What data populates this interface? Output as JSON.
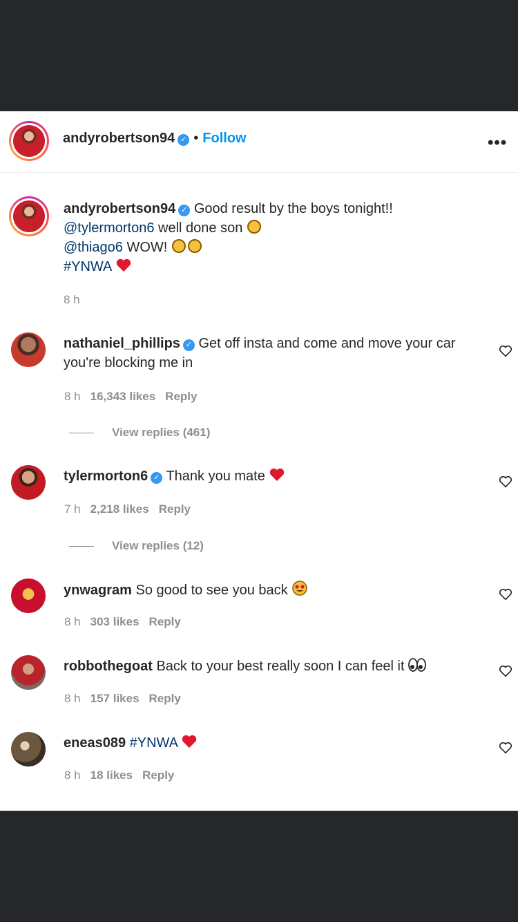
{
  "post": {
    "author": "andyrobertson94",
    "follow_label": "Follow",
    "caption_line1": "Good result by the boys tonight!!",
    "caption_mention1": "@tylermorton6",
    "caption_line2_rest": "well done son",
    "caption_mention2": "@thiago6",
    "caption_line3_rest": "WOW!",
    "caption_hashtag": "#YNWA",
    "caption_time": "8 h"
  },
  "comments": [
    {
      "user": "nathaniel_phillips",
      "verified": true,
      "text_line1": "Get off insta and come and move your car",
      "text_line2": "you're blocking me in",
      "time": "8 h",
      "likes": "16,343 likes",
      "reply": "Reply",
      "view_replies": "View replies (461)"
    },
    {
      "user": "tylermorton6",
      "verified": true,
      "text": "Thank you mate",
      "time": "7 h",
      "likes": "2,218 likes",
      "reply": "Reply",
      "view_replies": "View replies (12)"
    },
    {
      "user": "ynwagram",
      "text": "So good to see you back",
      "time": "8 h",
      "likes": "303 likes",
      "reply": "Reply"
    },
    {
      "user": "robbothegoat",
      "text": "Back to your best really soon I can feel it",
      "time": "8 h",
      "likes": "157 likes",
      "reply": "Reply"
    },
    {
      "user": "eneas089",
      "text": "#YNWA",
      "time": "8 h",
      "likes": "18 likes",
      "reply": "Reply"
    }
  ],
  "icons": [
    "verified-badge-icon",
    "more-options-icon",
    "heart-icon",
    "clap-icon",
    "red-heart-icon",
    "star-eyes-icon",
    "eyes-icon"
  ],
  "colors": {
    "accent": "#0095f6",
    "mention": "#00376b",
    "meta": "#8e8e8e",
    "frame": "#26272b"
  }
}
